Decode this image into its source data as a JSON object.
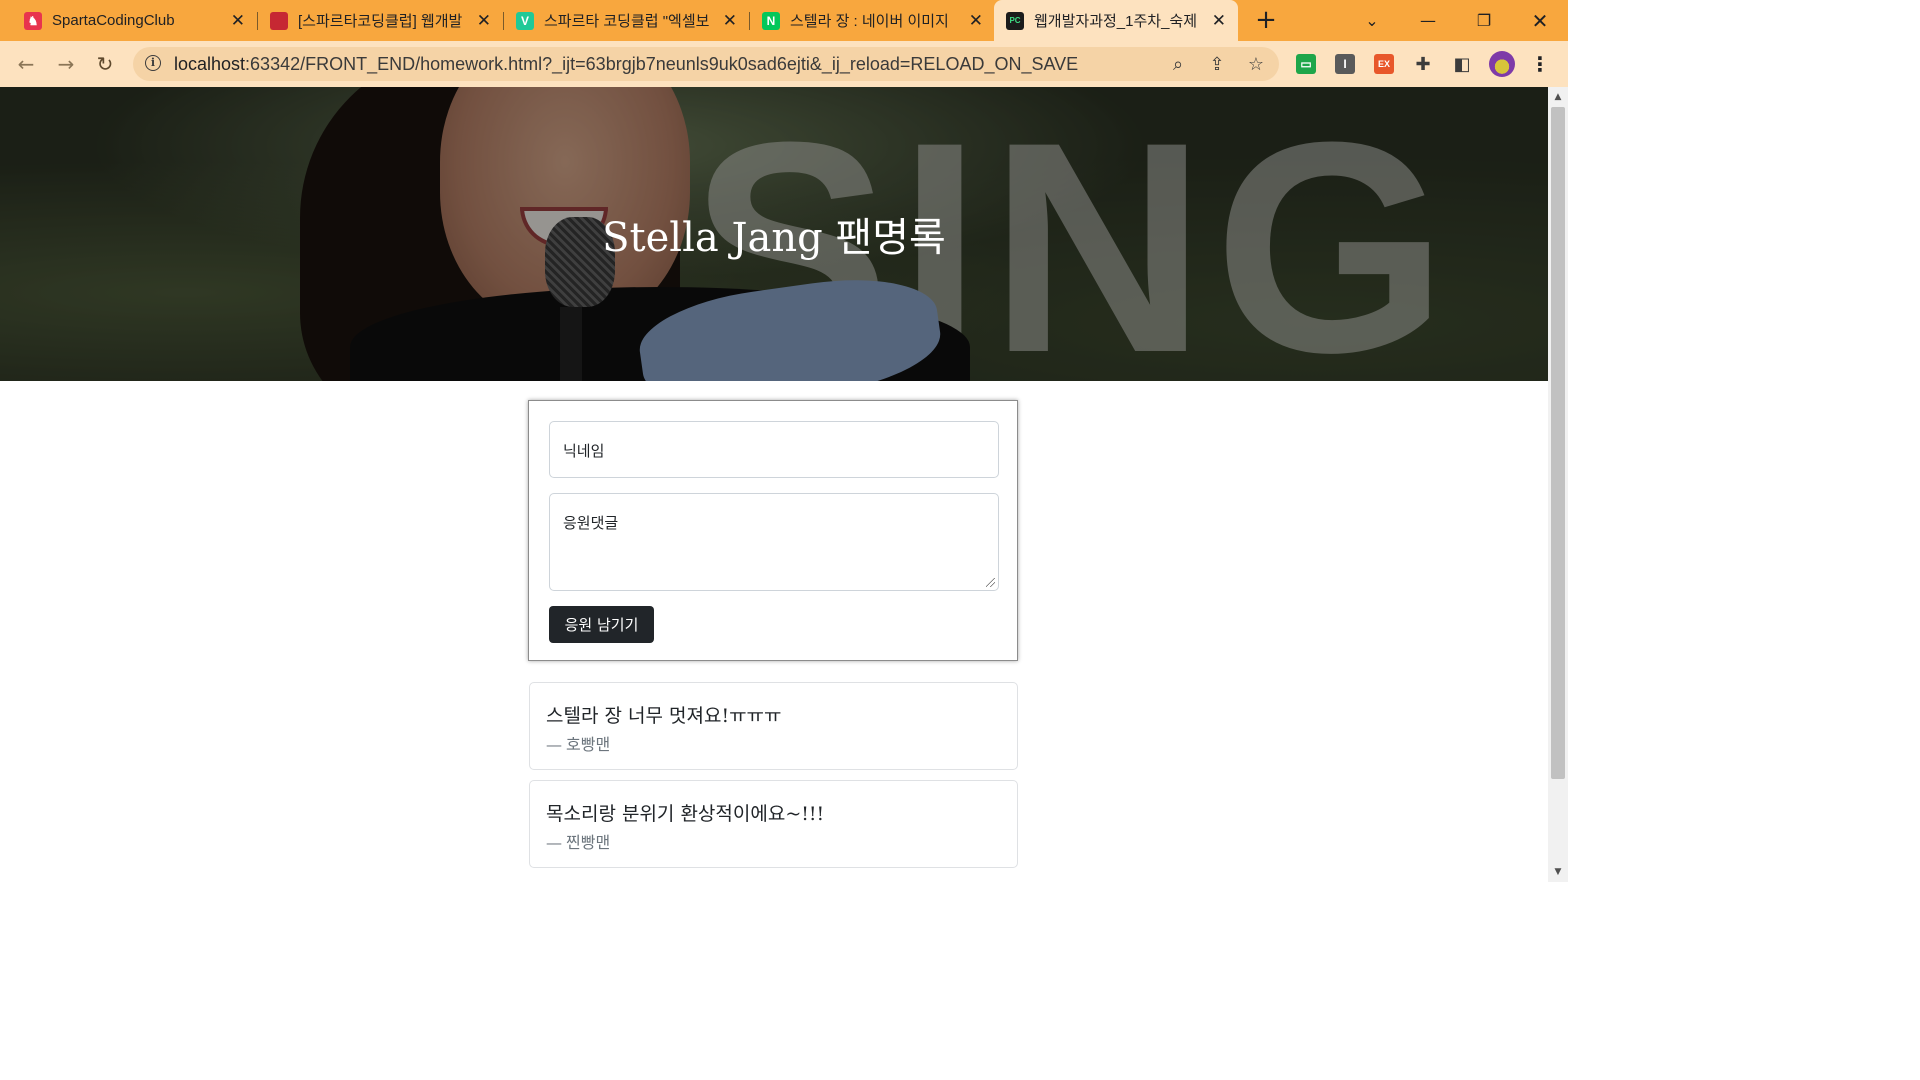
{
  "browser": {
    "tabs": [
      {
        "title": "SpartaCodingClub",
        "favicon_color": "#e8344e",
        "favicon_glyph": "♞",
        "active": false
      },
      {
        "title": "[스파르타코딩클럽] 웹개발",
        "favicon_color": "#c62833",
        "favicon_glyph": "▮",
        "active": false
      },
      {
        "title": "스파르타 코딩클럽 \"엑셀보",
        "favicon_color": "#20c997",
        "favicon_glyph": "V",
        "active": false
      },
      {
        "title": "스텔라 장 : 네이버 이미지",
        "favicon_color": "#03c75a",
        "favicon_glyph": "N",
        "active": false
      },
      {
        "title": "웹개발자과정_1주차_숙제",
        "favicon_color": "#1b1b1b",
        "favicon_glyph": "PC",
        "active": true
      }
    ],
    "new_tab_glyph": "+",
    "url_host": "localhost",
    "url_rest": ":63342/FRONT_END/homework.html?_ijt=63brgjb7neunls9uk0sad6ejti&_ij_reload=RELOAD_ON_SAVE",
    "icons": [
      "back-icon",
      "forward-icon",
      "reload-icon",
      "info-icon",
      "zoom-icon",
      "share-icon",
      "star-icon",
      "extensions-icon",
      "side-panel-icon",
      "profile-avatar",
      "menu-icon"
    ],
    "ext_badge_ex": "EX",
    "ext_badge_i": "I",
    "accent_color": "#f8a73e",
    "toolbar_color": "#fde2bf"
  },
  "page": {
    "hero_title": "Stella Jang 팬명록",
    "hero_bg_word": "SING",
    "form": {
      "nickname_label": "닉네임",
      "comment_label": "응원댓글",
      "submit_label": "응원 남기기"
    },
    "comments": [
      {
        "text": "스텔라 장 너무 멋져요!ㅠㅠㅠ",
        "author": "호빵맨"
      },
      {
        "text": "목소리랑 분위기 환상적이에요~!!!",
        "author": "찐빵맨"
      }
    ],
    "author_prefix": "—"
  }
}
